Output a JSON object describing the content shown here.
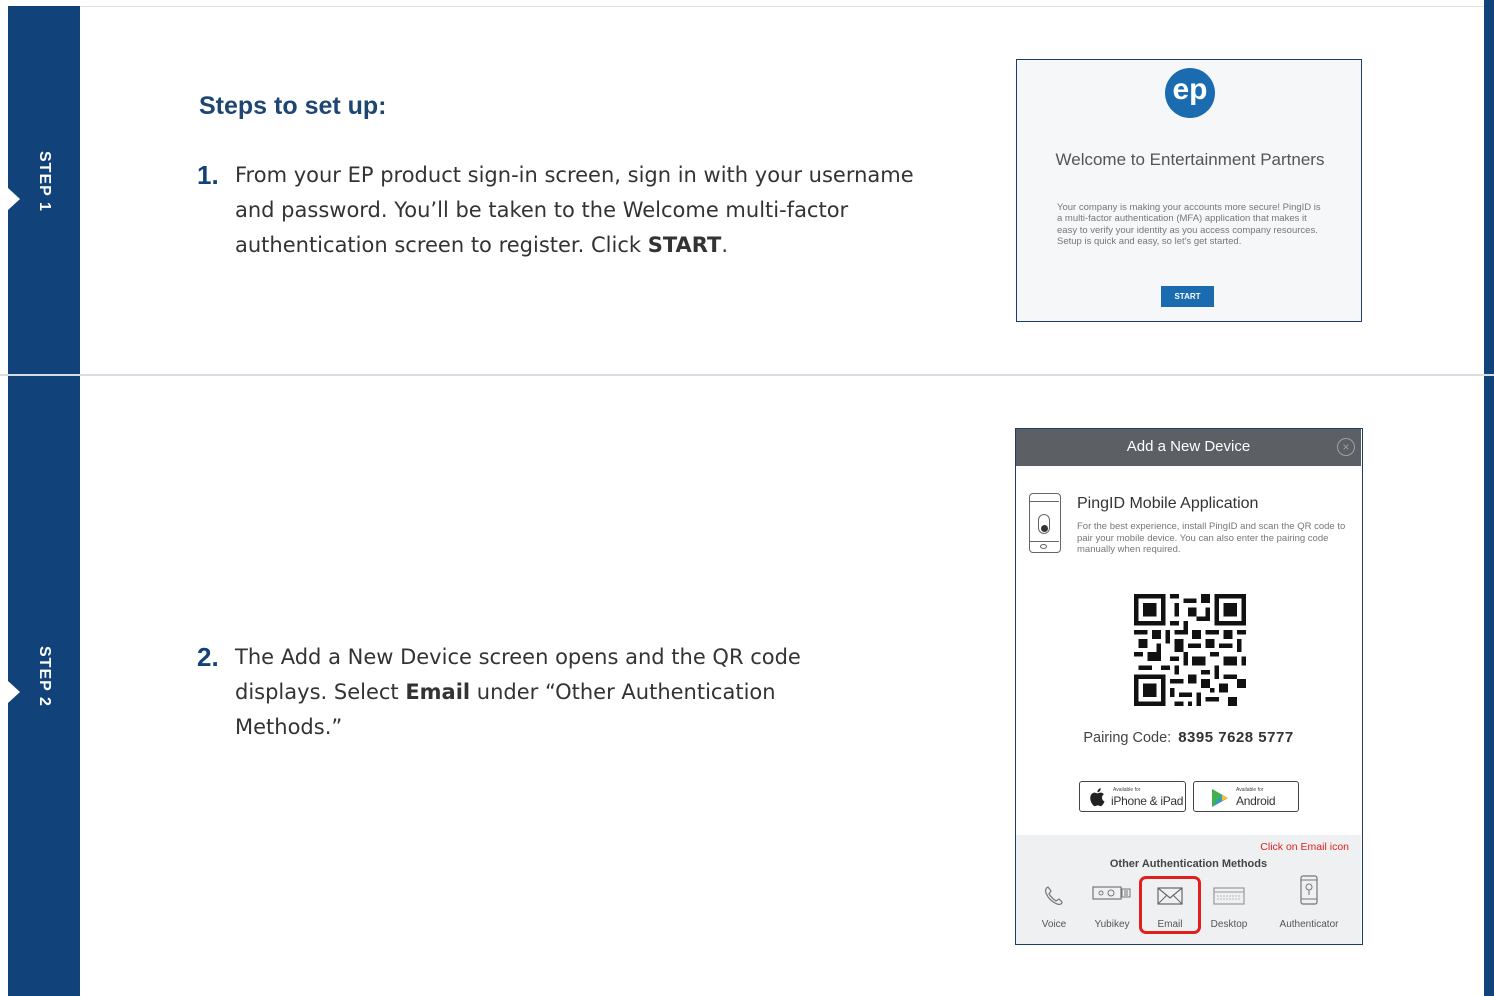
{
  "steps": [
    {
      "tab_label": "STEP 1",
      "number": "1.",
      "text_parts": [
        "From your EP product sign-in screen, sign in with your username and password. You’ll be taken to the Welcome multi-factor authentication screen to register. Click ",
        "START",
        "."
      ]
    },
    {
      "tab_label": "STEP 2",
      "number": "2.",
      "text_parts": [
        "The Add a New Device screen opens and the QR code displays. Select ",
        "Email",
        " under “Other Authentication Methods.”"
      ]
    }
  ],
  "heading": "Steps to set up:",
  "welcome_screen": {
    "logo_text": "ep",
    "title": "Welcome to Entertainment Partners",
    "body": "Your company is making your accounts more secure! PingID is a multi-factor authentication (MFA) application that makes it easy to verify your identity as you access company resources. Setup is quick and easy, so let's get started.",
    "start_button": "START"
  },
  "device_screen": {
    "header": "Add a New Device",
    "close_symbol": "×",
    "app_title": "PingID Mobile Application",
    "app_description": "For the best experience, install PingID and scan the QR code to pair your mobile device. You can also enter the pairing code manually when required.",
    "pairing_label": "Pairing Code:",
    "pairing_code": "8395 7628 5777",
    "ios_store_small": "Available for",
    "ios_store_big": "iPhone & iPad",
    "android_store_small": "Available for",
    "android_store_big": "Android",
    "click_note": "Click on Email icon",
    "other_methods_title": "Other Authentication Methods",
    "methods": [
      "Voice",
      "Yubikey",
      "Email",
      "Desktop",
      "Authenticator"
    ]
  },
  "colors": {
    "brand_navy": "#12427a",
    "heading_blue": "#1d4673",
    "ep_blue": "#1a6bb0",
    "highlight_red": "#e0201d"
  }
}
